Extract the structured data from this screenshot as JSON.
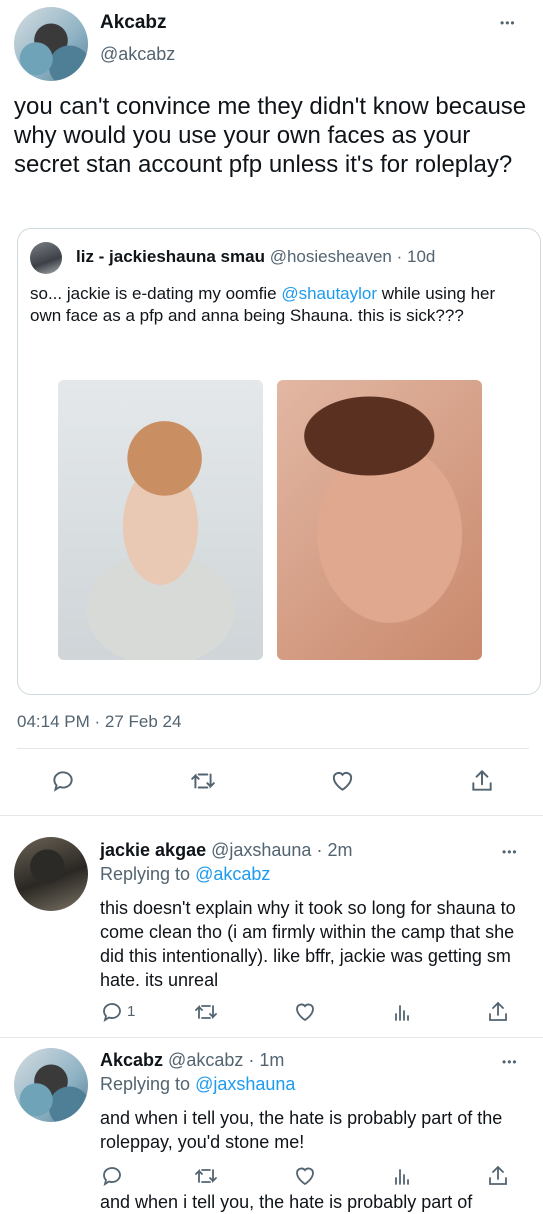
{
  "main_tweet": {
    "name": "Akcabz",
    "handle": "@akcabz",
    "text": "you can't convince me they didn't know because why would you use your own faces as your secret stan account pfp unless it's for roleplay?",
    "timestamp": "04:14 PM · 27 Feb 24"
  },
  "quoted_tweet": {
    "name": "liz - jackieshauna smau",
    "handle": "@hosiesheaven",
    "age": "· 10d",
    "text_before": "so... jackie is e-dating my oomfie ",
    "mention": "@shautaylor",
    "text_after": " while using her own face as a pfp and anna being Shauna. this is sick???"
  },
  "replies": [
    {
      "name": "jackie akgae",
      "handle": "@jaxshauna",
      "age": "· 2m",
      "replying_prefix": "Replying to ",
      "replying_to": "@akcabz",
      "text": "this doesn't explain why it took so long for shauna to come clean tho (i am firmly within the camp that she did this intentionally). like bffr, jackie was getting sm hate. its unreal",
      "reply_count": "1"
    },
    {
      "name": "Akcabz",
      "handle": "@akcabz",
      "age": "· 1m",
      "replying_prefix": "Replying to ",
      "replying_to": "@jaxshauna",
      "text": "and when i tell you, the hate is probably part of the roleppay, you'd stone me!"
    }
  ],
  "cutoff_text": "and when i tell you, the hate is probably part of",
  "more_glyph": "•••",
  "colors": {
    "accent": "#1d9bf0",
    "muted": "#536471"
  },
  "icons": [
    "reply-icon",
    "retweet-icon",
    "like-icon",
    "share-icon",
    "analytics-icon"
  ]
}
